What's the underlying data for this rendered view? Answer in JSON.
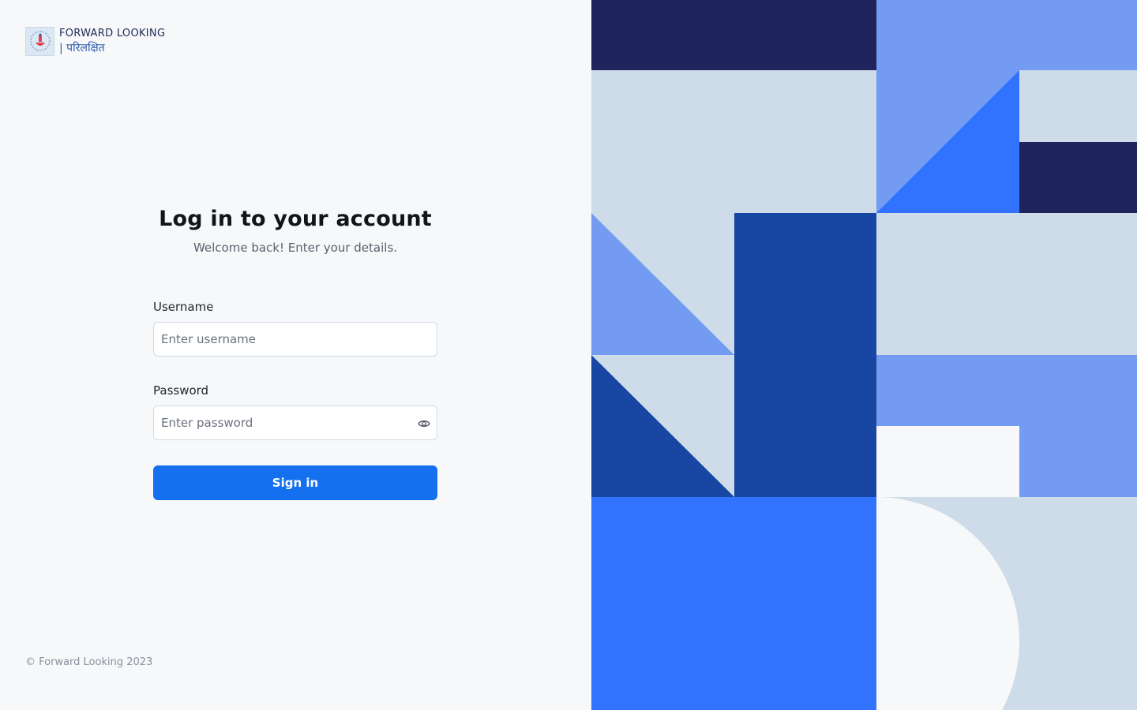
{
  "brand": {
    "title": "FORWARD LOOKING",
    "subtitle": "| परिलक्षित",
    "logo_icon": "emblem-logo"
  },
  "login": {
    "heading": "Log in to your account",
    "subheading": "Welcome back! Enter your details.",
    "username_label": "Username",
    "username_placeholder": "Enter username",
    "username_value": "",
    "password_label": "Password",
    "password_placeholder": "Enter password",
    "password_value": "",
    "password_toggle_icon": "eye-icon",
    "submit_label": "Sign in"
  },
  "footer": {
    "copyright": "© Forward Looking 2023"
  },
  "colors": {
    "background": "#f6f8fa",
    "primary": "#1570ef",
    "navy": "#1f245d",
    "deep_blue": "#1846a3",
    "bright_blue": "#3172ff",
    "soft_blue": "#739bf2",
    "pale_blue": "#cddce8"
  }
}
